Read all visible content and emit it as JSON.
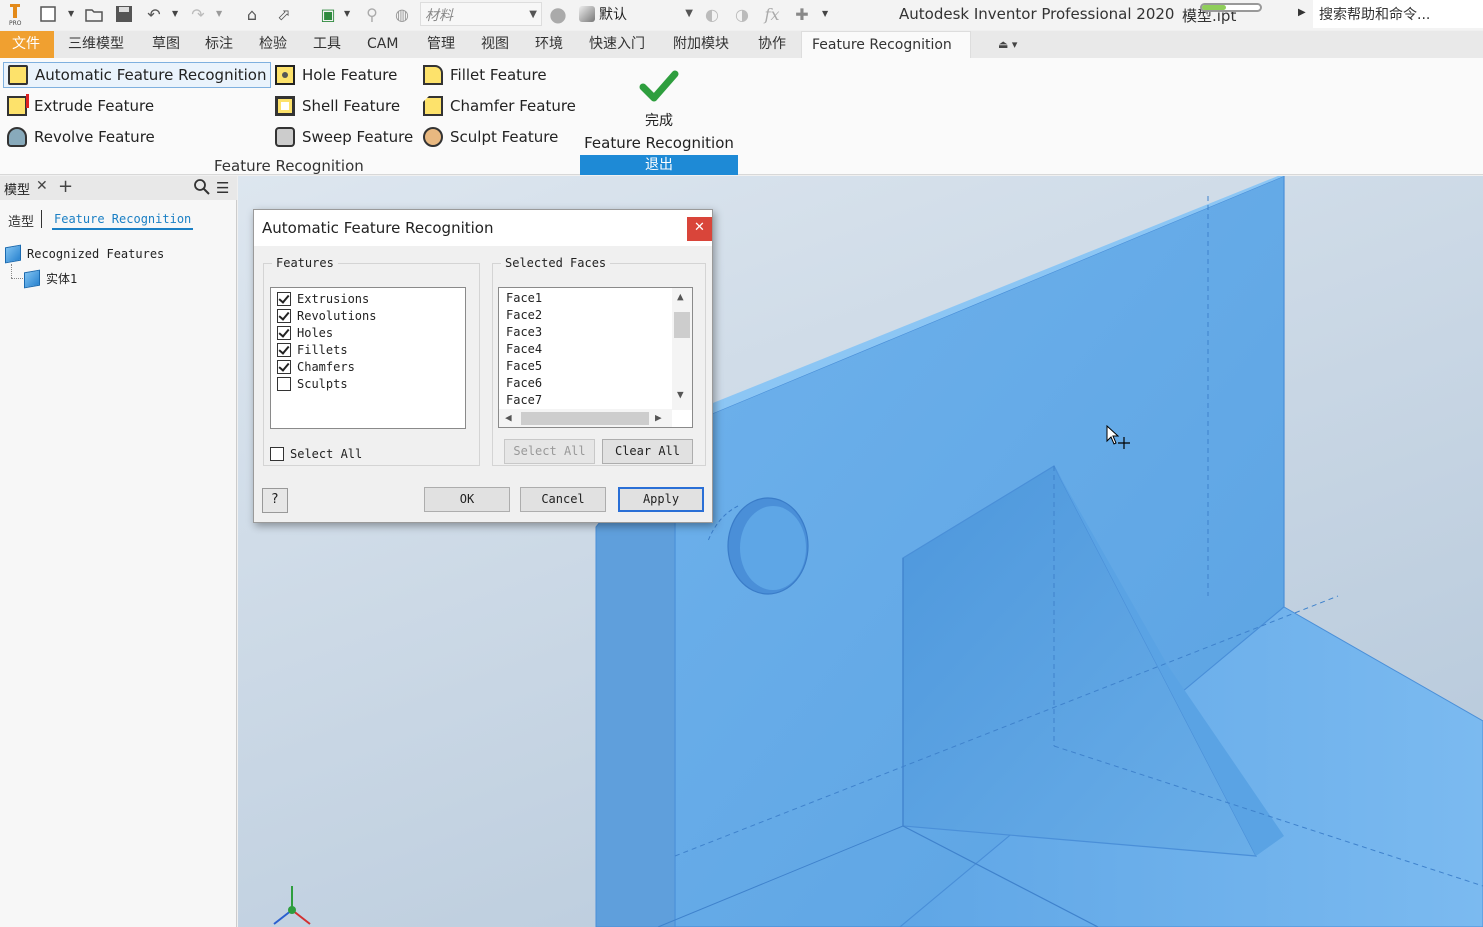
{
  "title_bar": {
    "material_placeholder": "材料",
    "appearance_value": "默认",
    "app_title": "Autodesk Inventor Professional 2020",
    "file_name": "模型.ipt",
    "help_search": "搜索帮助和命令...",
    "progress_fraction": 0.42
  },
  "ribbon_tabs": [
    "文件",
    "三维模型",
    "草图",
    "标注",
    "检验",
    "工具",
    "CAM",
    "管理",
    "视图",
    "环境",
    "快速入门",
    "附加模块",
    "协作",
    "Feature Recognition"
  ],
  "ribbon": {
    "buttons": {
      "automatic": "Automatic Feature Recognition",
      "extrude": "Extrude Feature",
      "revolve": "Revolve Feature",
      "hole": "Hole Feature",
      "shell": "Shell Feature",
      "sweep": "Sweep Feature",
      "fillet": "Fillet Feature",
      "chamfer": "Chamfer Feature",
      "sculpt": "Sculpt Feature"
    },
    "panel_label": "Feature Recognition",
    "finish_line1": "完成",
    "finish_line2": "Feature Recognition",
    "exit_label": "退出"
  },
  "browser": {
    "title": "模型",
    "tab_model": "造型",
    "tab_feature": "Feature Recognition",
    "tree": {
      "root": "Recognized Features",
      "child": "实体1"
    }
  },
  "dialog": {
    "title": "Automatic Feature Recognition",
    "features_group": "Features",
    "feature_items": [
      {
        "label": "Extrusions",
        "checked": true
      },
      {
        "label": "Revolutions",
        "checked": true
      },
      {
        "label": "Holes",
        "checked": true
      },
      {
        "label": "Fillets",
        "checked": true
      },
      {
        "label": "Chamfers",
        "checked": true
      },
      {
        "label": "Sculpts",
        "checked": false
      }
    ],
    "select_all_check": "Select All",
    "faces_group": "Selected Faces",
    "faces": [
      "Face1",
      "Face2",
      "Face3",
      "Face4",
      "Face5",
      "Face6",
      "Face7"
    ],
    "select_all_btn": "Select All",
    "clear_all_btn": "Clear All",
    "ok": "OK",
    "cancel": "Cancel",
    "apply": "Apply",
    "help_glyph": "?"
  },
  "colors": {
    "accent": "#1e8ad6",
    "file_tab": "#f0a030",
    "model_blue": "#6aaee8",
    "finish_green": "#2e9e3e"
  }
}
